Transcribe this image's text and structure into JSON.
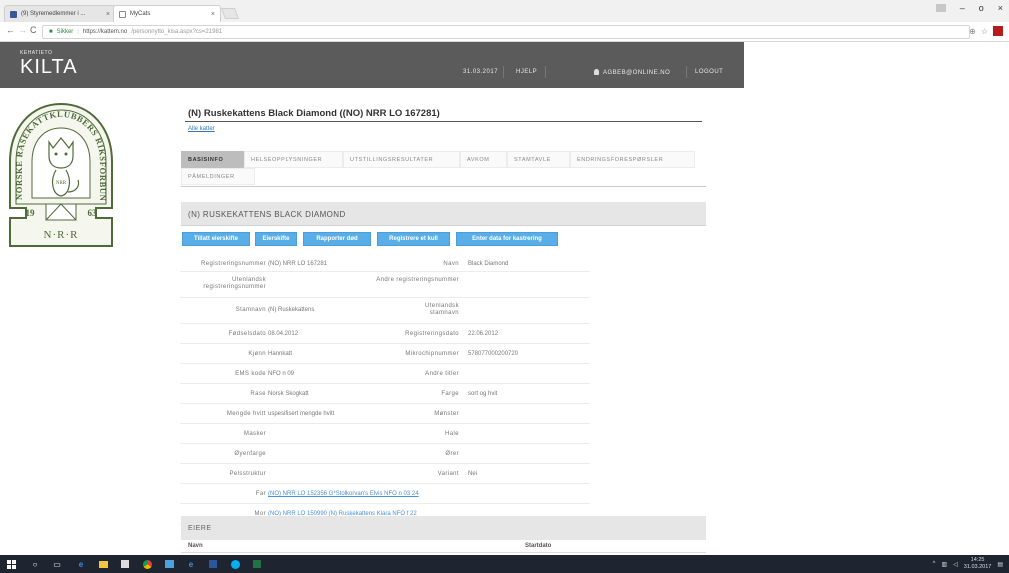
{
  "browser": {
    "tabs": [
      {
        "label": "(9) Styremedlemmer i ...",
        "active": false
      },
      {
        "label": "MyCats",
        "active": true
      }
    ],
    "secure_label": "Sikker",
    "url_host": "https://kattem.no",
    "url_path": "/personnytto_kisa.aspx?cs=21981",
    "window_controls": {
      "minimize": "–",
      "maximize": "o",
      "close": "×"
    }
  },
  "site": {
    "logo_small": "KEHATIETO",
    "logo_big": "KILTA",
    "header": {
      "date": "31.03.2017",
      "help": "HJELP",
      "user": "AGBEB@ONLINE.NO",
      "logout": "LOGOUT"
    },
    "crest": {
      "ring_text": "NORSKE RASEKATTKLUBBERS RIKSFORBUND",
      "year_left": "19",
      "year_right": "63",
      "abbrev": "N·R·R",
      "shield_letters": "NRR"
    }
  },
  "page": {
    "title": "(N) Ruskekattens Black Diamond ((NO) NRR LO 167281)",
    "back_link": "Alle katter",
    "tabs": [
      "BASISINFO",
      "HELSEOPPLYSNINGER",
      "UTSTILLINGSRESULTATER",
      "AVKOM",
      "STAMTAVLE",
      "ENDRINGSFORESPØRSLER",
      "PÅMELDINGER"
    ],
    "panel_title": "(N) RUSKEKATTENS BLACK DIAMOND",
    "buttons": [
      "Tillatt eierskifte",
      "Eierskifte",
      "Rapporter død",
      "Registrere et kull",
      "Enter data for kastrering"
    ],
    "info_rows": [
      {
        "l1": "Registreringsnummer",
        "v1": "(NO) NRR LO 167281",
        "l2": "Navn",
        "v2": "Black Diamond"
      },
      {
        "l1": "Utenlandsk registreringsnummer",
        "v1": "",
        "l2": "Andre registreringsnummer",
        "v2": ""
      },
      {
        "l1": "Stamnavn",
        "v1": "(N) Ruskekattens",
        "l2": "Utenlandsk stamnavn",
        "v2": ""
      },
      {
        "l1": "Fødselsdato",
        "v1": "08.04.2012",
        "l2": "Registreringsdato",
        "v2": "22.06.2012"
      },
      {
        "l1": "Kjønn",
        "v1": "Hannkatt",
        "l2": "Mikrochipnummer",
        "v2": "578077000200720"
      },
      {
        "l1": "EMS kode",
        "v1": "NFO n 09",
        "l2": "Andre titler",
        "v2": ""
      },
      {
        "l1": "Rase",
        "v1": "Norsk Skogkatt",
        "l2": "Farge",
        "v2": "sort og hvit"
      },
      {
        "l1": "Mengde hvitt",
        "v1": "uspesifisert mengde hvitt",
        "l2": "Mønster",
        "v2": ""
      },
      {
        "l1": "Masker",
        "v1": "",
        "l2": "Hale",
        "v2": ""
      },
      {
        "l1": "Øyenfarge",
        "v1": "",
        "l2": "Ører",
        "v2": ""
      },
      {
        "l1": "Pelsstruktur",
        "v1": "",
        "l2": "Variant",
        "v2": "Nei"
      },
      {
        "l1": "Far",
        "v1": "(NO) NRR LO 152356 G*Stolkorvan's Elvis NFO n 03 24",
        "l2": "",
        "v2": ""
      },
      {
        "l1": "Mor",
        "v1": "(NO) NRR LO 150990 (N) Ruskekattens Klara NFO f 22",
        "l2": "",
        "v2": ""
      }
    ],
    "owners_title": "EIERE",
    "owners_columns": [
      "Navn",
      "Startdato"
    ]
  },
  "taskbar": {
    "time": "14:25",
    "date": "31.03.2017"
  }
}
